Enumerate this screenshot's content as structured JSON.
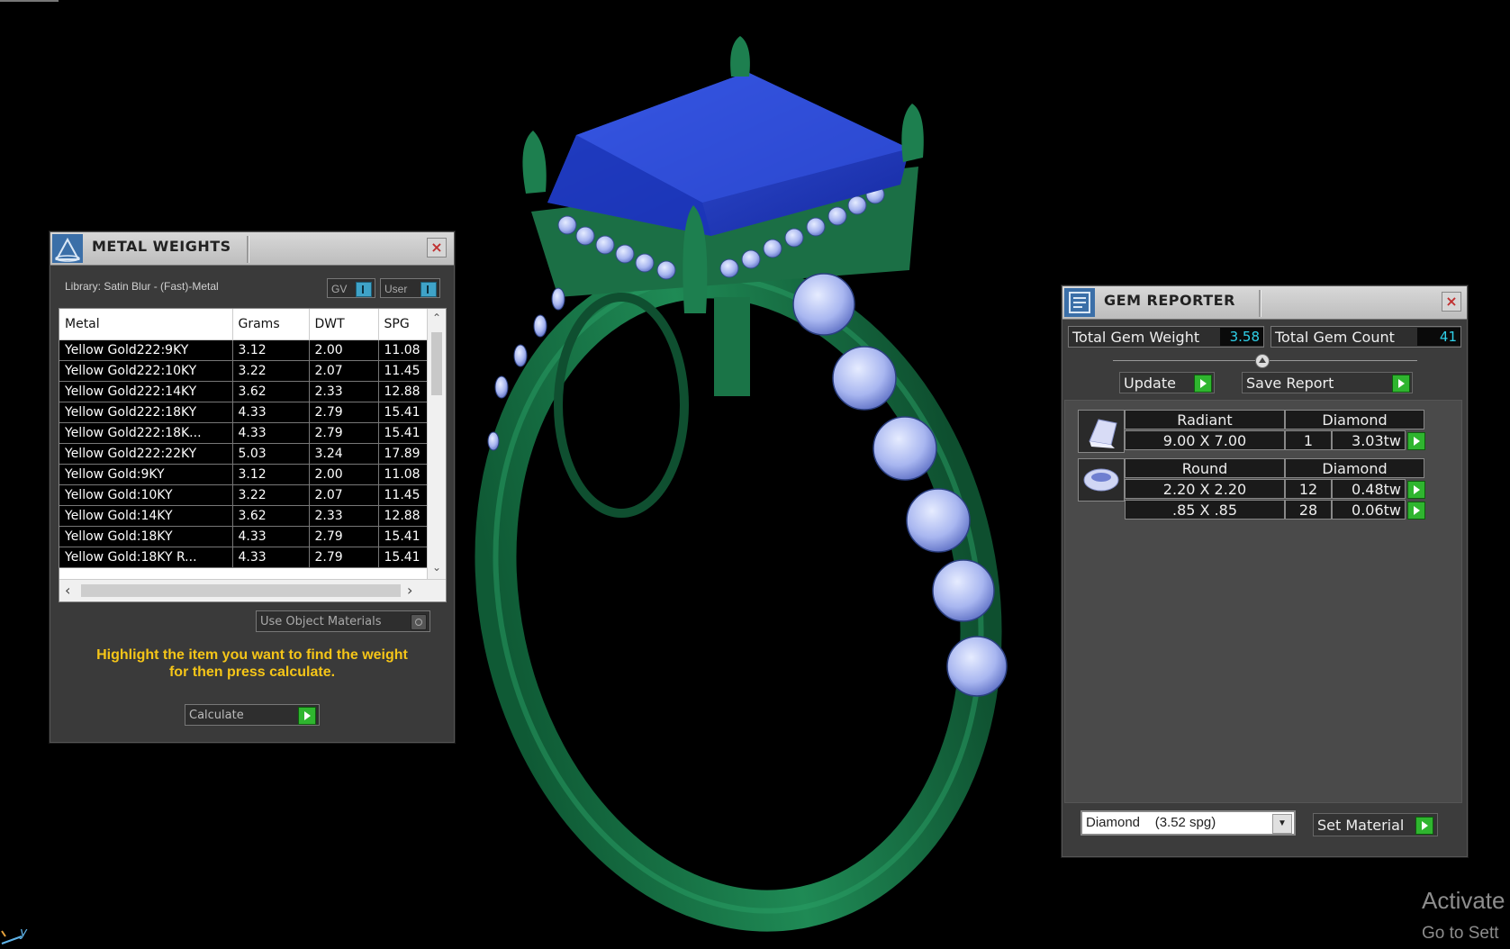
{
  "metal_weights": {
    "title": "METAL WEIGHTS",
    "close_glyph": "×",
    "library_label": "Library: Satin Blur - (Fast)-Metal",
    "toggle_gv": "GV",
    "toggle_user": "User",
    "columns": [
      "Metal",
      "Grams",
      "DWT",
      "SPG"
    ],
    "rows": [
      [
        "Yellow Gold222:9KY",
        "3.12",
        "2.00",
        "11.08"
      ],
      [
        "Yellow Gold222:10KY",
        "3.22",
        "2.07",
        "11.45"
      ],
      [
        "Yellow Gold222:14KY",
        "3.62",
        "2.33",
        "12.88"
      ],
      [
        "Yellow Gold222:18KY",
        "4.33",
        "2.79",
        "15.41"
      ],
      [
        "Yellow Gold222:18K...",
        "4.33",
        "2.79",
        "15.41"
      ],
      [
        "Yellow Gold222:22KY",
        "5.03",
        "3.24",
        "17.89"
      ],
      [
        "Yellow Gold:9KY",
        "3.12",
        "2.00",
        "11.08"
      ],
      [
        "Yellow Gold:10KY",
        "3.22",
        "2.07",
        "11.45"
      ],
      [
        "Yellow Gold:14KY",
        "3.62",
        "2.33",
        "12.88"
      ],
      [
        "Yellow Gold:18KY",
        "4.33",
        "2.79",
        "15.41"
      ],
      [
        "Yellow Gold:18KY R...",
        "4.33",
        "2.79",
        "15.41"
      ]
    ],
    "use_object_materials": "Use Object Materials",
    "hint_line1": "Highlight the item you want to find the weight",
    "hint_line2": "for then press calculate.",
    "calculate": "Calculate"
  },
  "gem_reporter": {
    "title": "GEM REPORTER",
    "close_glyph": "×",
    "total_weight_label": "Total Gem Weight",
    "total_weight_value": "3.58",
    "total_count_label": "Total Gem Count",
    "total_count_value": "41",
    "update": "Update",
    "save_report": "Save Report",
    "gems": [
      {
        "shape": "Radiant",
        "material": "Diamond",
        "thumb_icon": "radiant-gem-icon",
        "sizes": [
          {
            "size": "9.00 X 7.00",
            "count": "1",
            "weight": "3.03tw"
          }
        ]
      },
      {
        "shape": "Round",
        "material": "Diamond",
        "thumb_icon": "round-gem-icon",
        "sizes": [
          {
            "size": "2.20 X 2.20",
            "count": "12",
            "weight": "0.48tw"
          },
          {
            "size": ".85 X .85",
            "count": "28",
            "weight": "0.06tw"
          }
        ]
      }
    ],
    "material_select": "Diamond    (3.52 spg)",
    "set_material": "Set Material"
  },
  "watermark": {
    "line1": "Activate",
    "line2": "Go to Sett"
  },
  "axis_label": "y",
  "colors": {
    "metal_green": "#1e7a4c",
    "center_stone": "#1f3fc0",
    "side_stones": "#b8c4f4",
    "hint_text": "#f5c518",
    "value_cyan": "#2fd0e8",
    "button_green": "#2fb52f"
  }
}
